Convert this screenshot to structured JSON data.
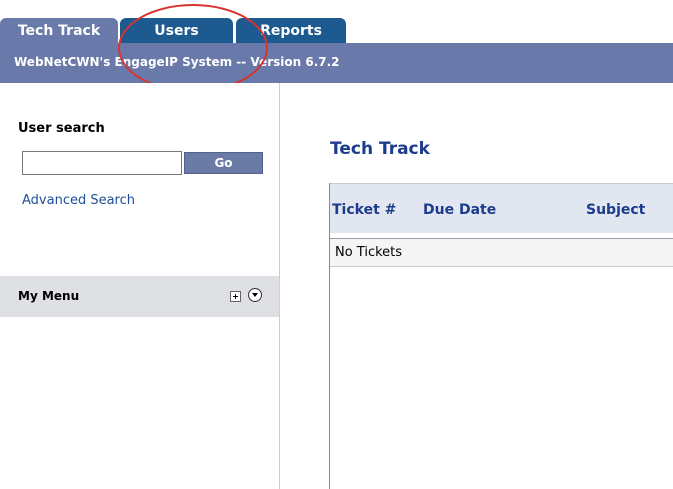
{
  "tabs": [
    {
      "label": "Tech Track",
      "active": true
    },
    {
      "label": "Users",
      "active": false
    },
    {
      "label": "Reports",
      "active": false
    }
  ],
  "header": {
    "title": "WebNetCWN's EngageIP System -- Version 6.7.2"
  },
  "sidebar": {
    "search_label": "User search",
    "search_value": "",
    "go_label": "Go",
    "advanced_link": "Advanced Search",
    "menu_label": "My Menu",
    "menu_icons": [
      "expand-plus-icon",
      "chevron-down-circle-icon"
    ]
  },
  "main": {
    "title": "Tech Track",
    "columns": [
      "Ticket #",
      "Due Date",
      "Subject"
    ],
    "empty_message": "No Tickets"
  },
  "colors": {
    "tab_active": "#6979a9",
    "tab_inactive": "#1d5a8f",
    "header_bar": "#6979a9",
    "title_blue": "#1c3c8c",
    "annotation_red": "#d8332e"
  }
}
